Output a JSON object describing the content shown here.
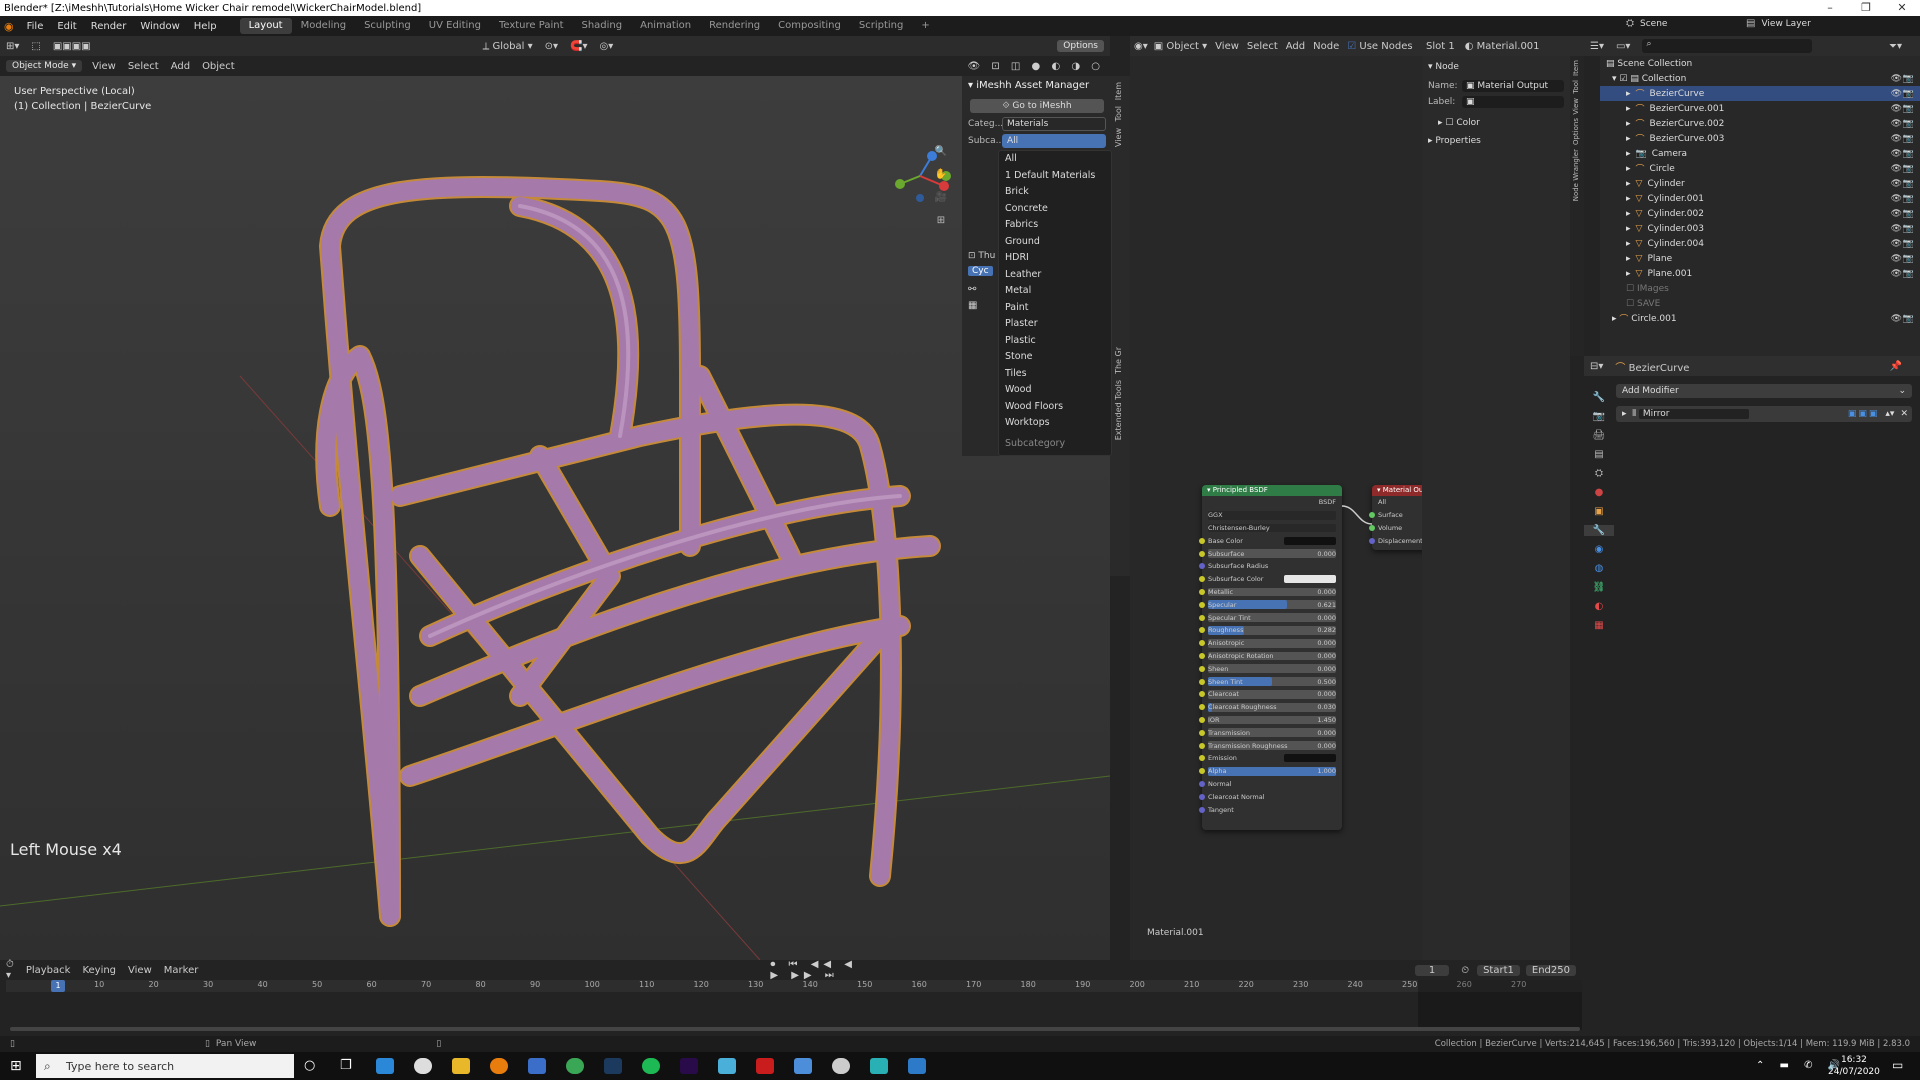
{
  "titlebar": {
    "title": "Blender* [Z:\\iMeshh\\Tutorials\\Home Wicker Chair remodel\\WickerChairModel.blend]"
  },
  "menus": [
    "File",
    "Edit",
    "Render",
    "Window",
    "Help"
  ],
  "workspaces": [
    "Layout",
    "Modeling",
    "Sculpting",
    "UV Editing",
    "Texture Paint",
    "Shading",
    "Animation",
    "Rendering",
    "Compositing",
    "Scripting"
  ],
  "active_workspace": "Layout",
  "scene": "Scene",
  "view_layer": "View Layer",
  "viewport": {
    "transform": "Global",
    "options": "Options",
    "mode": "Object Mode",
    "menu": [
      "View",
      "Select",
      "Add",
      "Object"
    ],
    "info_line1": "User Perspective (Local)",
    "info_line2": "(1) Collection | BezierCurve",
    "key_hint": "Left Mouse x4"
  },
  "asset_manager": {
    "title": "iMeshh Asset Manager",
    "goto": "Go to iMeshh",
    "category_label": "Categ...",
    "category_value": "Materials",
    "subcategory_label": "Subca...",
    "subcategory_value": "All",
    "stub1": "Thu",
    "stub2": "Cyc",
    "tabs": [
      "Item",
      "Tool",
      "View"
    ],
    "tabs_lower": [
      "The Gr",
      "Extended Tools"
    ]
  },
  "dropdown": {
    "options": [
      "All",
      "1 Default Materials",
      "Brick",
      "Concrete",
      "Fabrics",
      "Ground",
      "HDRI",
      "Leather",
      "Metal",
      "Paint",
      "Plaster",
      "Plastic",
      "Stone",
      "Tiles",
      "Wood",
      "Wood Floors",
      "Worktops"
    ],
    "caption": "Subcategory"
  },
  "node_editor": {
    "object": "Object",
    "menu": [
      "View",
      "Select",
      "Add",
      "Node"
    ],
    "use_nodes": "Use Nodes",
    "slot": "Slot 1",
    "material": "Material.001",
    "material_label": "Material.001",
    "bsdf": {
      "title": "Principled BSDF",
      "output": "BSDF",
      "dist": "GGX",
      "sss": "Christensen-Burley",
      "rows": [
        {
          "name": "Base Color",
          "value": "",
          "bar": 0
        },
        {
          "name": "Subsurface",
          "value": "0.000",
          "bar": 0
        },
        {
          "name": "Subsurface Radius",
          "value": "",
          "bar": 0
        },
        {
          "name": "Subsurface Color",
          "value": "",
          "bar": 0
        },
        {
          "name": "Metallic",
          "value": "0.000",
          "bar": 0
        },
        {
          "name": "Specular",
          "value": "0.621",
          "bar": 0.621
        },
        {
          "name": "Specular Tint",
          "value": "0.000",
          "bar": 0
        },
        {
          "name": "Roughness",
          "value": "0.282",
          "bar": 0.282
        },
        {
          "name": "Anisotropic",
          "value": "0.000",
          "bar": 0
        },
        {
          "name": "Anisotropic Rotation",
          "value": "0.000",
          "bar": 0
        },
        {
          "name": "Sheen",
          "value": "0.000",
          "bar": 0
        },
        {
          "name": "Sheen Tint",
          "value": "0.500",
          "bar": 0.5
        },
        {
          "name": "Clearcoat",
          "value": "0.000",
          "bar": 0
        },
        {
          "name": "Clearcoat Roughness",
          "value": "0.030",
          "bar": 0.03
        },
        {
          "name": "IOR",
          "value": "1.450",
          "bar": 0
        },
        {
          "name": "Transmission",
          "value": "0.000",
          "bar": 0
        },
        {
          "name": "Transmission Roughness",
          "value": "0.000",
          "bar": 0
        },
        {
          "name": "Emission",
          "value": "",
          "bar": 0
        },
        {
          "name": "Alpha",
          "value": "1.000",
          "bar": 1
        },
        {
          "name": "Normal",
          "value": "",
          "bar": 0
        },
        {
          "name": "Clearcoat Normal",
          "value": "",
          "bar": 0
        },
        {
          "name": "Tangent",
          "value": "",
          "bar": 0
        }
      ]
    },
    "output_node": {
      "title": "Material Ou",
      "target": "All",
      "inputs": [
        "Surface",
        "Volume",
        "Displacement"
      ]
    }
  },
  "node_sidebar": {
    "section": "Node",
    "name_label": "Name:",
    "name_value": "Material Output",
    "label_label": "Label:",
    "color": "Color",
    "properties": "Properties",
    "tabs": [
      "Item",
      "Tool",
      "View",
      "Options",
      "Node Wrangler"
    ]
  },
  "outliner": {
    "root": "Scene Collection",
    "collection": "Collection",
    "items": [
      "BezierCurve",
      "BezierCurve.001",
      "BezierCurve.002",
      "BezierCurve.003",
      "Camera",
      "Circle",
      "Cylinder",
      "Cylinder.001",
      "Cylinder.002",
      "Cylinder.003",
      "Cylinder.004",
      "Plane",
      "Plane.001"
    ],
    "extra": [
      "IMages",
      "SAVE"
    ],
    "last": "Circle.001"
  },
  "properties": {
    "object": "BezierCurve",
    "add_modifier": "Add Modifier",
    "modifier": "Mirror"
  },
  "timeline": {
    "menu": [
      "Playback",
      "Keying",
      "View",
      "Marker"
    ],
    "current_frame": "1",
    "start_label": "Start",
    "start": "1",
    "end_label": "End",
    "end": "250",
    "ticks": [
      "1",
      "10",
      "20",
      "30",
      "40",
      "50",
      "60",
      "70",
      "80",
      "90",
      "100",
      "110",
      "120",
      "130",
      "140",
      "150",
      "160",
      "170",
      "180",
      "190",
      "200",
      "210",
      "220",
      "230",
      "240",
      "250",
      "260",
      "270"
    ]
  },
  "statusbar": {
    "left": "Pan View",
    "right": "Collection | BezierCurve | Verts:214,645 | Faces:196,560 | Tris:393,120 | Objects:1/14 | Mem: 119.9 MiB | 2.83.0"
  },
  "taskbar": {
    "search_placeholder": "Type here to search",
    "time": "16:32",
    "date": "24/07/2020"
  },
  "colors": {
    "accent": "#4772b3",
    "selection": "#334d80",
    "chair": "#a57aaa",
    "node_green": "#2f7c46",
    "node_red": "#8f2a2a"
  }
}
